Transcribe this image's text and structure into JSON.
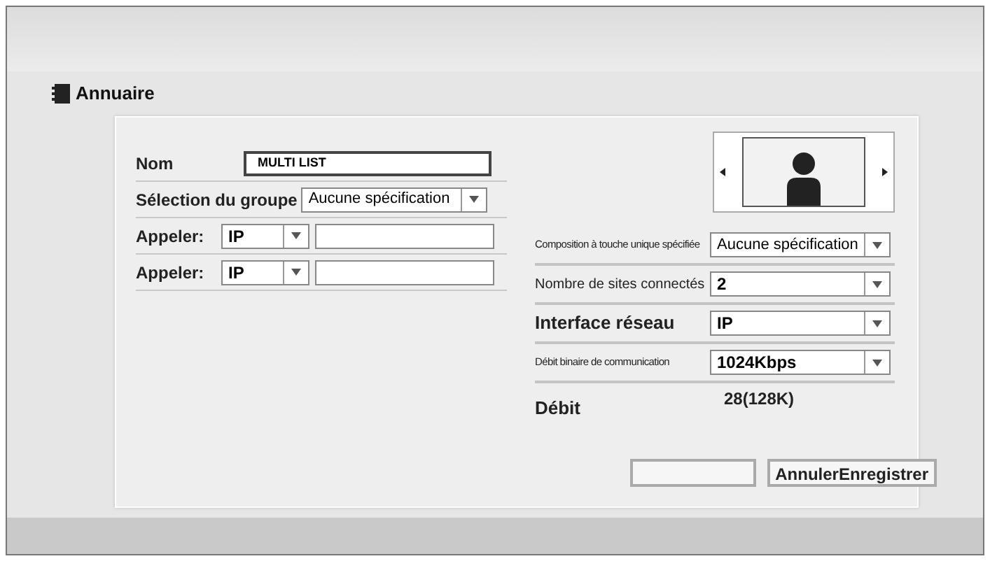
{
  "window": {
    "title": "Annuaire"
  },
  "left_fields": [
    {
      "kind": "text",
      "label": "Nom",
      "value": "MULTI LIST"
    },
    {
      "kind": "select",
      "label": "Sélection du groupe",
      "value": "Aucune spécification"
    },
    {
      "kind": "call",
      "label": "Appeler:",
      "value": "IP"
    },
    {
      "kind": "call",
      "label": "Appeler:",
      "value": "IP"
    }
  ],
  "right_fields": [
    {
      "kind": "compact",
      "label": "Composition à touche unique spécifiée",
      "value": "Aucune spécification"
    },
    {
      "kind": "select",
      "label": "Nombre de sites connectés",
      "value": "2"
    },
    {
      "kind": "bold",
      "label": "Interface réseau",
      "value": "IP"
    },
    {
      "kind": "compact",
      "label": "Débit binaire de communication",
      "value": "1024Kbps"
    },
    {
      "kind": "reading",
      "label": "Débit",
      "value": "28(128K)"
    }
  ],
  "buttons": [
    {
      "label": "AnnulerEnregistrer"
    }
  ]
}
